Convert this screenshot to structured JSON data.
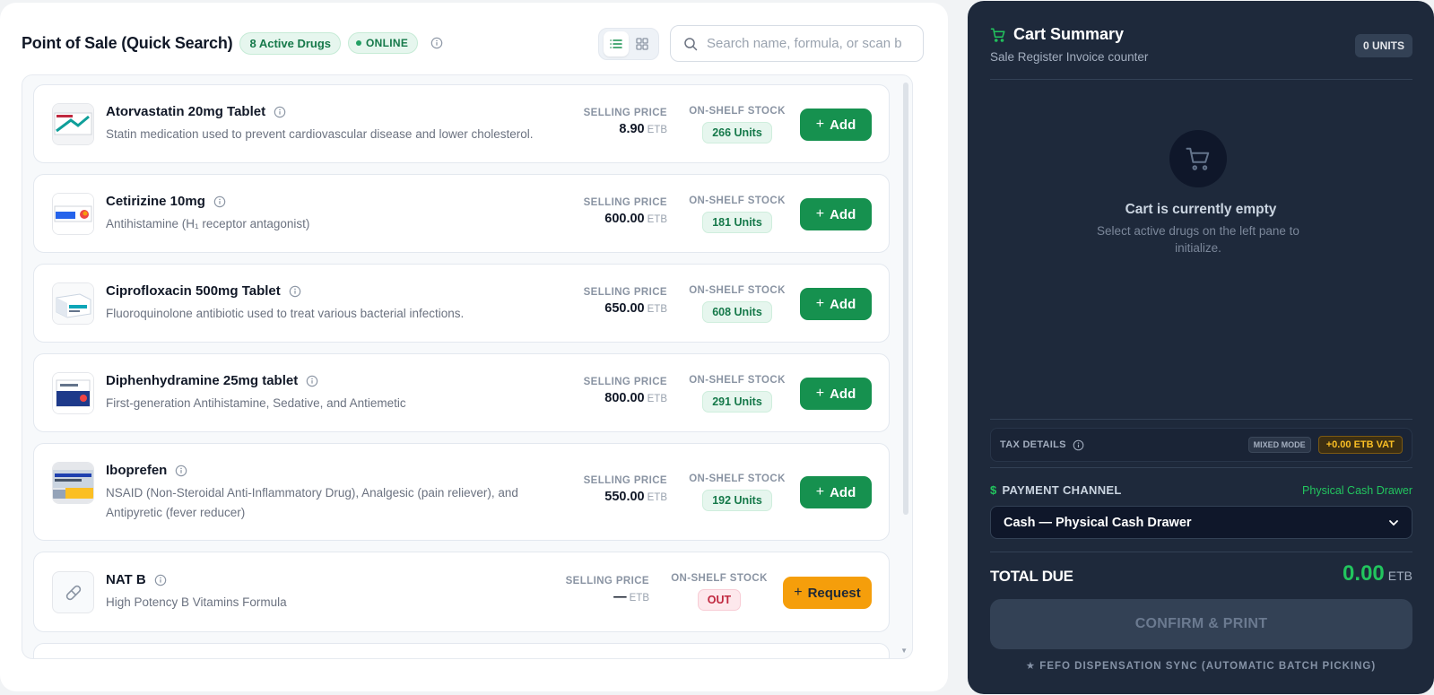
{
  "header": {
    "title": "Point of Sale (Quick Search)",
    "active_badge": "8 Active Drugs",
    "status_badge": "ONLINE",
    "search_placeholder": "Search name, formula, or scan b"
  },
  "labels": {
    "selling_price": "SELLING PRICE",
    "on_shelf_stock": "ON-SHELF STOCK",
    "currency": "ETB",
    "add": "Add",
    "request": "Request"
  },
  "drugs": [
    {
      "name": "Atorvastatin 20mg Tablet",
      "desc": "Statin medication used to prevent cardiovascular disease and lower cholesterol.",
      "price": "8.90",
      "stock": "266 Units"
    },
    {
      "name": "Cetirizine 10mg",
      "desc": "Antihistamine (H₁ receptor antagonist)",
      "price": "600.00",
      "stock": "181 Units"
    },
    {
      "name": "Ciprofloxacin 500mg Tablet",
      "desc": "Fluoroquinolone antibiotic used to treat various bacterial infections.",
      "price": "650.00",
      "stock": "608 Units"
    },
    {
      "name": "Diphenhydramine 25mg tablet",
      "desc": "First-generation Antihistamine, Sedative, and Antiemetic",
      "price": "800.00",
      "stock": "291 Units"
    },
    {
      "name": "Iboprefen",
      "desc": "NSAID (Non-Steroidal Anti-Inflammatory Drug), Analgesic (pain reliever), and Antipyretic (fever reducer)",
      "price": "550.00",
      "stock": "192 Units"
    },
    {
      "name": "NAT B",
      "desc": "High Potency B Vitamins Formula",
      "price": "—",
      "stock": "OUT"
    }
  ],
  "cart": {
    "title": "Cart Summary",
    "subtitle": "Sale Register Invoice counter",
    "units": "0 UNITS",
    "empty_title": "Cart is currently empty",
    "empty_desc": "Select active drugs on the left pane to initialize.",
    "tax_label": "TAX DETAILS",
    "mixed_mode": "MIXED MODE",
    "vat": "+0.00 ETB VAT",
    "payment_label": "PAYMENT CHANNEL",
    "payment_right": "Physical Cash Drawer",
    "payment_value": "Cash — Physical Cash Drawer",
    "total_label": "TOTAL DUE",
    "total_value": "0.00",
    "total_currency": "ETB",
    "confirm": "CONFIRM & PRINT",
    "footer": "★ FEFO DISPENSATION SYNC (AUTOMATIC BATCH PICKING)"
  },
  "colors": {
    "accent_green": "#16914f",
    "request_orange": "#f59e0b",
    "cart_bg": "#1e293b"
  }
}
